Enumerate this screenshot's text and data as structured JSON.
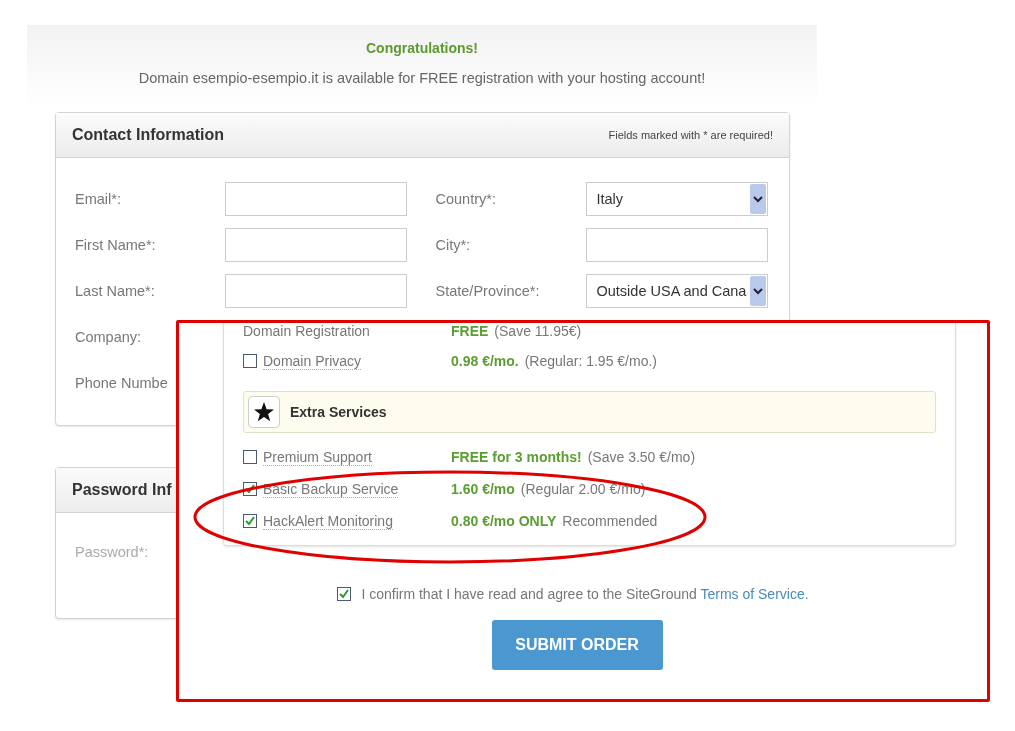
{
  "banner": {
    "title": "Congratulations!",
    "message": "Domain esempio-esempio.it is available for FREE registration with your hosting account!"
  },
  "contact": {
    "title": "Contact Information",
    "note": "Fields marked with * are required!",
    "left_fields": [
      {
        "label": "Email*:",
        "kind": "text"
      },
      {
        "label": "First Name*:",
        "kind": "text"
      },
      {
        "label": "Last Name*:",
        "kind": "text"
      },
      {
        "label": "Company:",
        "kind": "label"
      },
      {
        "label": "Phone Numbe",
        "kind": "label"
      }
    ],
    "right_fields": [
      {
        "label": "Country*:",
        "kind": "select",
        "value": "Italy"
      },
      {
        "label": "City*:",
        "kind": "text"
      },
      {
        "label": "State/Province*:",
        "kind": "select",
        "value": "Outside USA and Cana"
      }
    ]
  },
  "password": {
    "title": "Password Inf",
    "fields": [
      {
        "label": "Password*:"
      }
    ]
  },
  "services": {
    "rows": [
      {
        "label": "Domain Registration",
        "kind": "plain",
        "price": "FREE",
        "note": "(Save 11.95€)"
      },
      {
        "label": "Domain Privacy",
        "kind": "checkbox",
        "checked": false,
        "price": "0.98 €/mo.",
        "note": "(Regular: 1.95 €/mo.)"
      }
    ],
    "extra_title": "Extra Services",
    "extras": [
      {
        "label": "Premium Support",
        "checked": false,
        "price": "FREE for 3 months!",
        "note": "(Save 3.50 €/mo)"
      },
      {
        "label": "Basic Backup Service",
        "checked": true,
        "price": "1.60 €/mo",
        "note": "(Regular 2.00 €/mo)"
      },
      {
        "label": "HackAlert Monitoring",
        "checked": true,
        "price": "0.80 €/mo ONLY",
        "note": "Recommended"
      }
    ]
  },
  "confirm": {
    "checked": true,
    "text": "I confirm that I have read and agree to the SiteGround ",
    "link": "Terms of Service."
  },
  "submit": "SUBMIT ORDER"
}
